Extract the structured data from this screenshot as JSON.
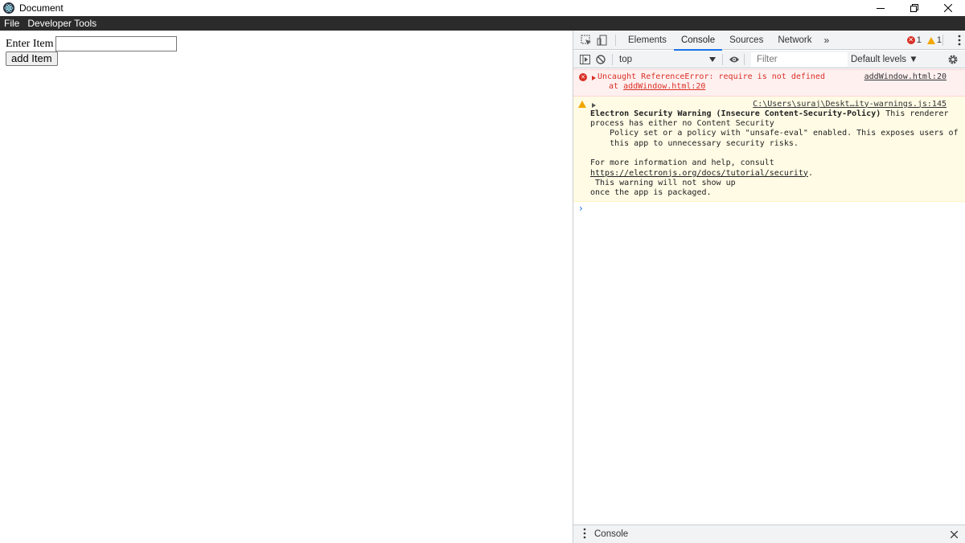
{
  "window": {
    "title": "Document",
    "icon": "electron-icon"
  },
  "menu": {
    "file": "File",
    "developer_tools": "Developer Tools"
  },
  "app": {
    "input_label": "Enter Item",
    "input_value": "",
    "add_button": "add Item"
  },
  "devtools": {
    "tabs": [
      "Elements",
      "Console",
      "Sources",
      "Network"
    ],
    "active_tab": "Console",
    "more_tabs": "»",
    "error_count": "1",
    "warning_count": "1",
    "context": "top",
    "filter_placeholder": "Filter",
    "levels": "Default levels ▼",
    "messages": {
      "error": {
        "text": "Uncaught ReferenceError: require is not defined",
        "at": "at",
        "at_link": "addWindow.html:20",
        "source": "addWindow.html:20"
      },
      "warning": {
        "source": "C:\\Users\\suraj\\Deskt…ity-warnings.js:145",
        "title": "Electron Security Warning (Insecure Content-Security-Policy)",
        "line1_tail": " This renderer",
        "line2": "process has either no Content Security",
        "line3": "    Policy set or a policy with \"unsafe-eval\" enabled. This exposes users of",
        "line4": "    this app to unnecessary security risks.",
        "line5": "For more information and help, consult",
        "link": "https://electronjs.org/docs/tutorial/security",
        "link_tail": ".",
        "line7": " This warning will not show up",
        "line8": "once the app is packaged."
      }
    },
    "prompt": "›",
    "drawer_label": "Console"
  },
  "colors": {
    "menubar_bg": "#2b2b2b",
    "devtools_bg": "#f1f3f4",
    "accent": "#1a73e8",
    "error": "#d93025",
    "warning": "#f2a600"
  }
}
